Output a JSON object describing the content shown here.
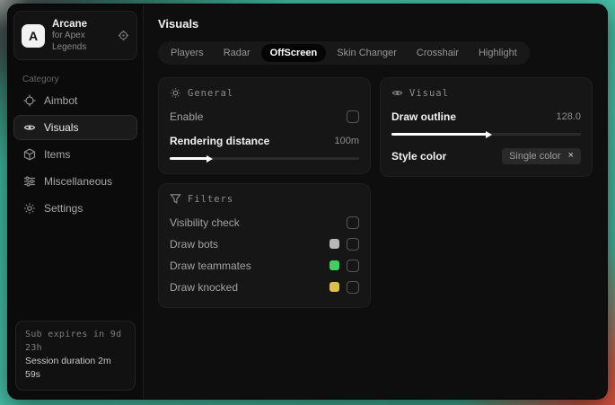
{
  "app": {
    "logo_letter": "A",
    "name": "Arcane",
    "subtitle": "for Apex Legends"
  },
  "sidebar": {
    "category_label": "Category",
    "items": [
      {
        "label": "Aimbot"
      },
      {
        "label": "Visuals"
      },
      {
        "label": "Items"
      },
      {
        "label": "Miscellaneous"
      },
      {
        "label": "Settings"
      }
    ],
    "session": {
      "sub_expires": "Sub expires in 9d 23h",
      "duration": "Session duration 2m 59s"
    }
  },
  "header": {
    "title": "Visuals"
  },
  "tabs": [
    {
      "label": "Players"
    },
    {
      "label": "Radar"
    },
    {
      "label": "OffScreen"
    },
    {
      "label": "Skin Changer"
    },
    {
      "label": "Crosshair"
    },
    {
      "label": "Highlight"
    }
  ],
  "active_tab": "OffScreen",
  "panels": {
    "general": {
      "title": "General",
      "enable_label": "Enable",
      "enable_checked": false,
      "rendering_label": "Rendering distance",
      "rendering_value": "100m",
      "rendering_percent": 20
    },
    "filters": {
      "title": "Filters",
      "rows": [
        {
          "label": "Visibility check",
          "swatch": null,
          "checked": false
        },
        {
          "label": "Draw bots",
          "swatch": "#b8b8b8",
          "checked": false
        },
        {
          "label": "Draw teammates",
          "swatch": "#3ed160",
          "checked": false
        },
        {
          "label": "Draw knocked",
          "swatch": "#ddc04c",
          "checked": false
        }
      ]
    },
    "visual": {
      "title": "Visual",
      "outline_label": "Draw outline",
      "outline_value": "128.0",
      "outline_percent": 50,
      "style_label": "Style color",
      "style_selected": "Single color",
      "style_clear": "×"
    }
  },
  "colors": {
    "accent_teal": "#4cc4ab",
    "accent_red": "#e0503a",
    "swatch_gray": "#b8b8b8",
    "swatch_green": "#3ed160",
    "swatch_yellow": "#ddc04c"
  }
}
